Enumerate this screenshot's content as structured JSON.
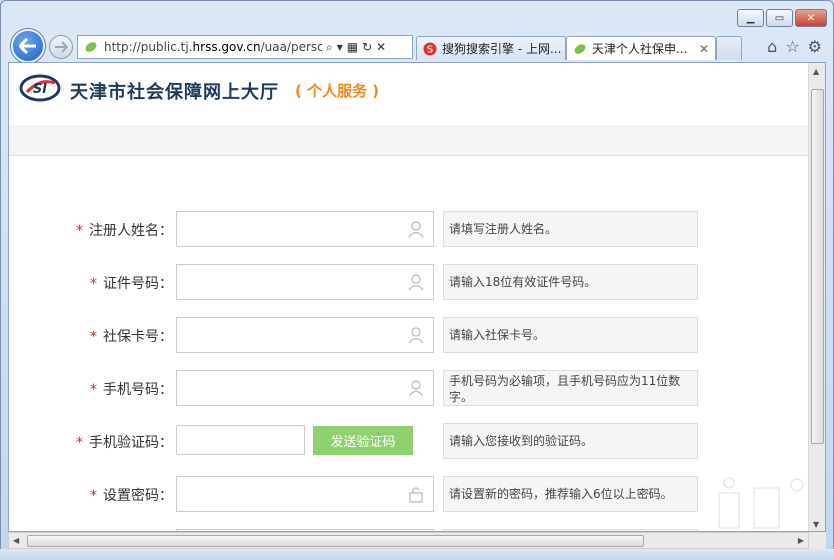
{
  "browser": {
    "address_url_prefix": "http://public.tj.",
    "address_url_domain": "hrss.gov.cn",
    "address_url_suffix": "/uaa/person",
    "tabs": [
      {
        "label": "搜狗搜索引擎 - 上网..."
      },
      {
        "label": "天津个人社保申..."
      }
    ]
  },
  "header": {
    "title": "天津市社会保障网上大厅",
    "subtitle": "( 个人服务 )"
  },
  "form": {
    "required_mark": "*",
    "fields": [
      {
        "label": "注册人姓名：",
        "hint": "请填写注册人姓名。"
      },
      {
        "label": "证件号码：",
        "hint": "请输入18位有效证件号码。"
      },
      {
        "label": "社保卡号：",
        "hint": "请输入社保卡号。"
      },
      {
        "label": "手机号码：",
        "hint": "手机号码为必输项，且手机号码应为11位数字。"
      },
      {
        "label": "手机验证码：",
        "hint": "请输入您接收到的验证码。"
      },
      {
        "label": "设置密码：",
        "hint": "请设置新的密码，推荐输入6位以上密码。"
      }
    ],
    "send_code_label": "发送验证码"
  },
  "colors": {
    "brand": "#223a5e",
    "accent": "#f0891e",
    "required": "#e02020",
    "send_button": "#8fd16e"
  }
}
